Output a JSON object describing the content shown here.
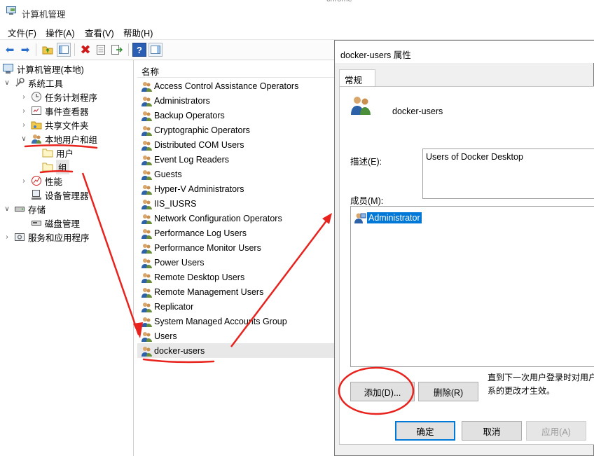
{
  "window": {
    "title": "计算机管理",
    "background_app_fragment": "chrome"
  },
  "menu": [
    "文件(F)",
    "操作(A)",
    "查看(V)",
    "帮助(H)"
  ],
  "tree": {
    "root": "计算机管理(本地)",
    "system_tools": "系统工具",
    "task_scheduler": "任务计划程序",
    "event_viewer": "事件查看器",
    "shared_folders": "共享文件夹",
    "local_users_groups": "本地用户和组",
    "users": "用户",
    "groups": "组",
    "performance": "性能",
    "device_manager": "设备管理器",
    "storage": "存储",
    "disk_management": "磁盘管理",
    "services_apps": "服务和应用程序"
  },
  "list": {
    "column_name": "名称",
    "groups": [
      "Access Control Assistance Operators",
      "Administrators",
      "Backup Operators",
      "Cryptographic Operators",
      "Distributed COM Users",
      "Event Log Readers",
      "Guests",
      "Hyper-V Administrators",
      "IIS_IUSRS",
      "Network Configuration Operators",
      "Performance Log Users",
      "Performance Monitor Users",
      "Power Users",
      "Remote Desktop Users",
      "Remote Management Users",
      "Replicator",
      "System Managed Accounts Group",
      "Users",
      "docker-users"
    ],
    "selected": "docker-users"
  },
  "dialog": {
    "title": "docker-users 属性",
    "tab_general": "常规",
    "group_name": "docker-users",
    "description_label": "描述(E):",
    "description_value": "Users of Docker Desktop",
    "members_label": "成员(M):",
    "members": [
      "Administrator"
    ],
    "add_button": "添加(D)...",
    "remove_button": "删除(R)",
    "note_line1": "直到下一次用户登录时对用户",
    "note_line2": "系的更改才生效。",
    "ok_button": "确定",
    "cancel_button": "取消",
    "apply_button": "应用(A)"
  },
  "colors": {
    "selection_blue": "#0078d7",
    "annotation_red": "#e8231e"
  }
}
